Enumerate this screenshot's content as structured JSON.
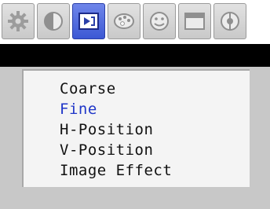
{
  "tabs": [
    {
      "icon": "gear-icon",
      "active": false
    },
    {
      "icon": "contrast-icon",
      "active": false
    },
    {
      "icon": "image-adjust-icon",
      "active": true
    },
    {
      "icon": "color-palette-icon",
      "active": false
    },
    {
      "icon": "face-icon",
      "active": false
    },
    {
      "icon": "window-icon",
      "active": false
    },
    {
      "icon": "audio-icon",
      "active": false
    }
  ],
  "colors": {
    "active_tab": "#3c58d4",
    "selected_item": "#1f36c8",
    "panel": "#f4f4f4",
    "frame": "#c8c8c8"
  },
  "menu": {
    "selected_index": 1,
    "items": [
      {
        "label": "Coarse"
      },
      {
        "label": "Fine"
      },
      {
        "label": "H-Position"
      },
      {
        "label": "V-Position"
      },
      {
        "label": "Image Effect"
      }
    ]
  }
}
